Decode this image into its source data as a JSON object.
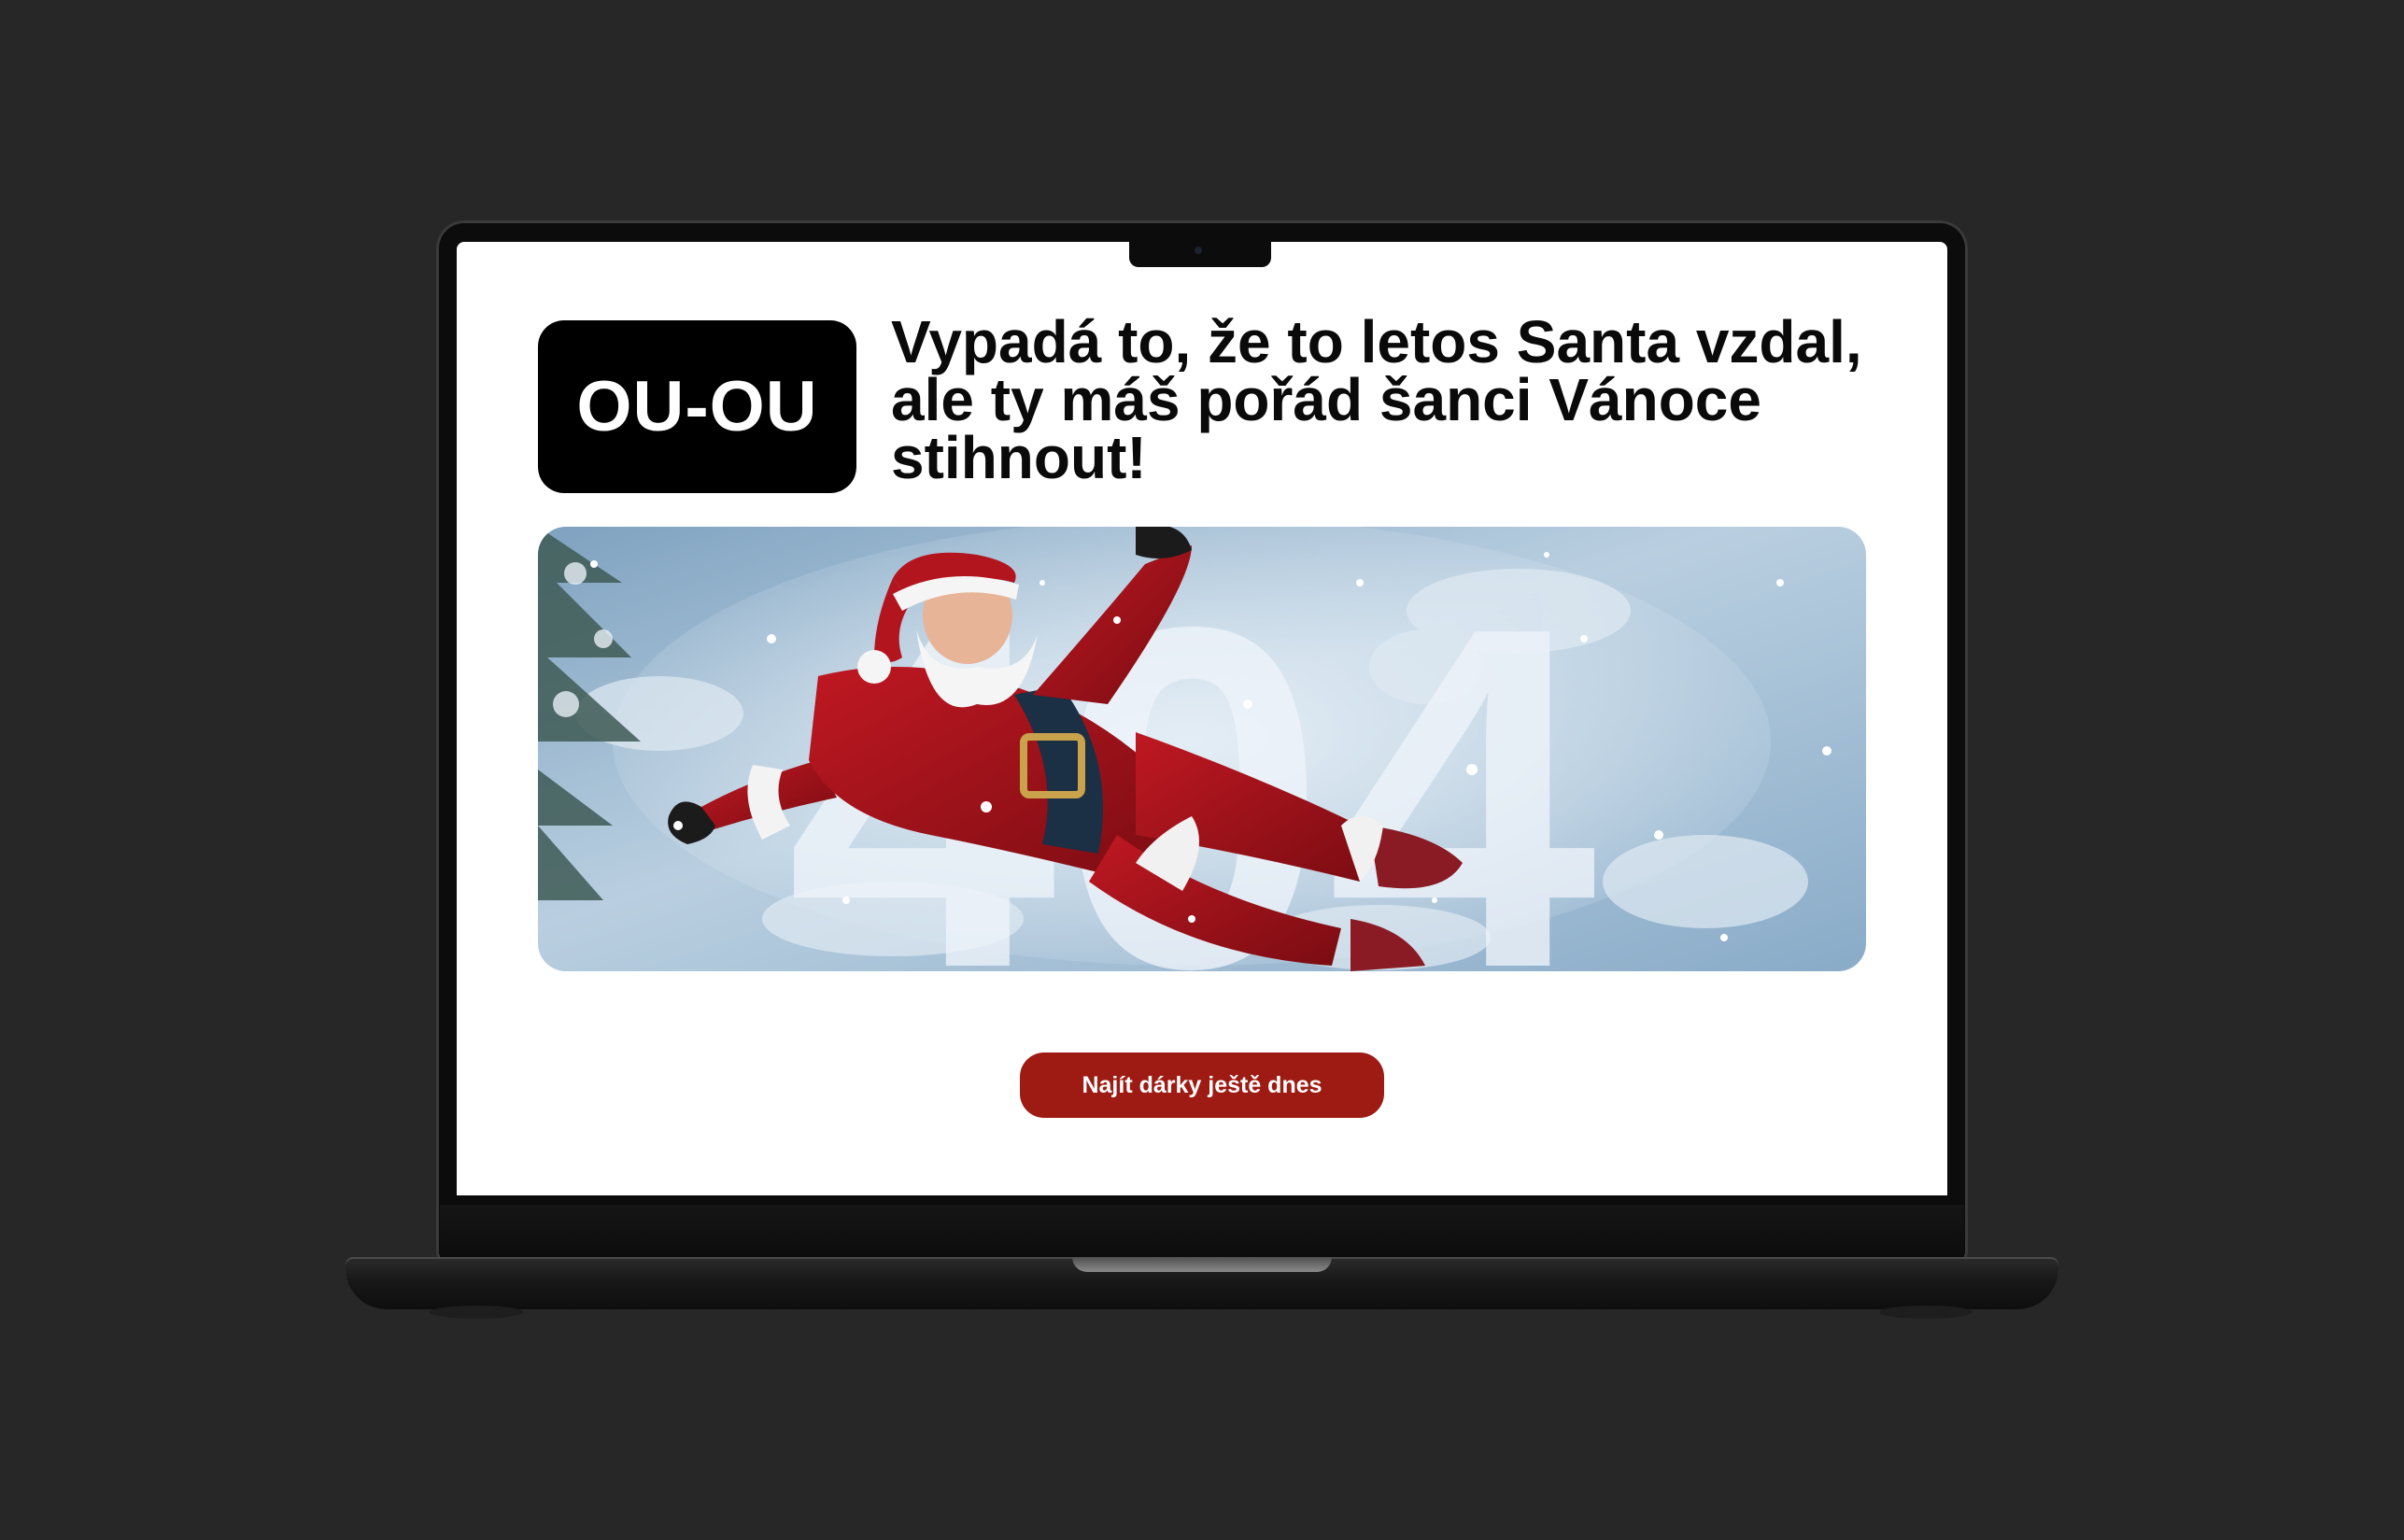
{
  "page": {
    "badge": "OU-OU",
    "headline": "Vypadá to, že to letos Santa vzdal, ale ty máš pořád šanci Vánoce stihnout!",
    "hero_number": "404",
    "cta_label": "Najít dárky ještě dnes"
  },
  "colors": {
    "background": "#272727",
    "screen": "#ffffff",
    "badge_bg": "#000000",
    "cta_bg": "#9e1b14",
    "hero_snow": "#a9c4db"
  },
  "icons": {
    "hero_image": "santa-snow-angel-illustration"
  }
}
